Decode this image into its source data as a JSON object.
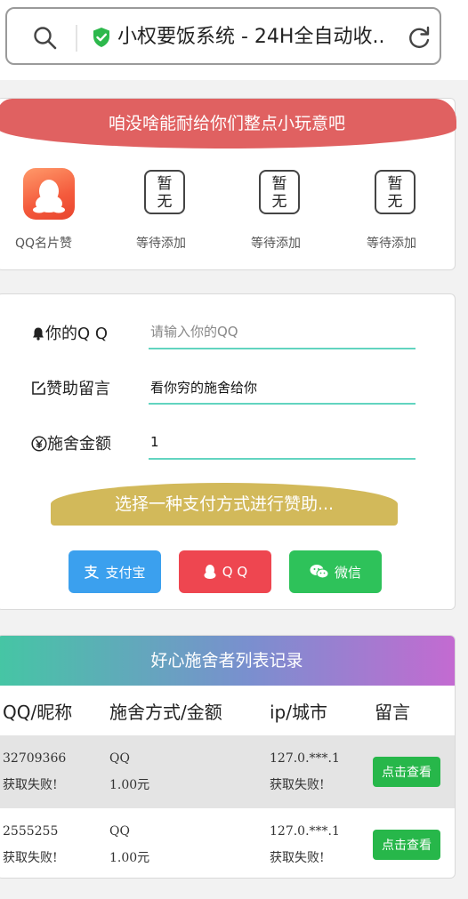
{
  "browser": {
    "title": "小权要饭系统 - 24H全自动收..."
  },
  "tools": {
    "banner": "咱没啥能耐给你们整点小玩意吧",
    "items": [
      {
        "label": "QQ名片赞",
        "icon": "qq-app-icon"
      },
      {
        "label": "等待添加",
        "placeholder_text": "暂无"
      },
      {
        "label": "等待添加",
        "placeholder_text": "暂无"
      },
      {
        "label": "等待添加",
        "placeholder_text": "暂无"
      }
    ]
  },
  "form": {
    "qq_label": "你的Q Q",
    "qq_placeholder": "请输入你的QQ",
    "message_label": "赞助留言",
    "message_value": "看你穷的施舍给你",
    "amount_label": "施舍金额",
    "amount_value": "1",
    "pay_banner": "选择一种支付方式进行赞助...",
    "pay_alipay": "支付宝",
    "pay_qq": "Q Q",
    "pay_wechat": "微信"
  },
  "records": {
    "banner": "好心施舍者列表记录",
    "columns": [
      "QQ/昵称",
      "施舍方式/金额",
      "ip/城市",
      "留言"
    ],
    "rows": [
      {
        "qq": "32709366",
        "nick": "获取失败!",
        "method": "QQ",
        "amount": "1.00元",
        "ip": "127.0.***.1",
        "city": "获取失败!",
        "action": "点击查看"
      },
      {
        "qq": "2555255",
        "nick": "获取失败!",
        "method": "QQ",
        "amount": "1.00元",
        "ip": "127.0.***.1",
        "city": "获取失败!",
        "action": "点击查看"
      }
    ]
  },
  "colors": {
    "banner_red": "#e06161",
    "banner_gold": "#d2b95a",
    "alipay_blue": "#3ba0ee",
    "qq_red": "#ee4650",
    "wechat_green": "#2ec25a",
    "input_underline": "#62d4c0",
    "view_button_green": "#27b74a"
  }
}
